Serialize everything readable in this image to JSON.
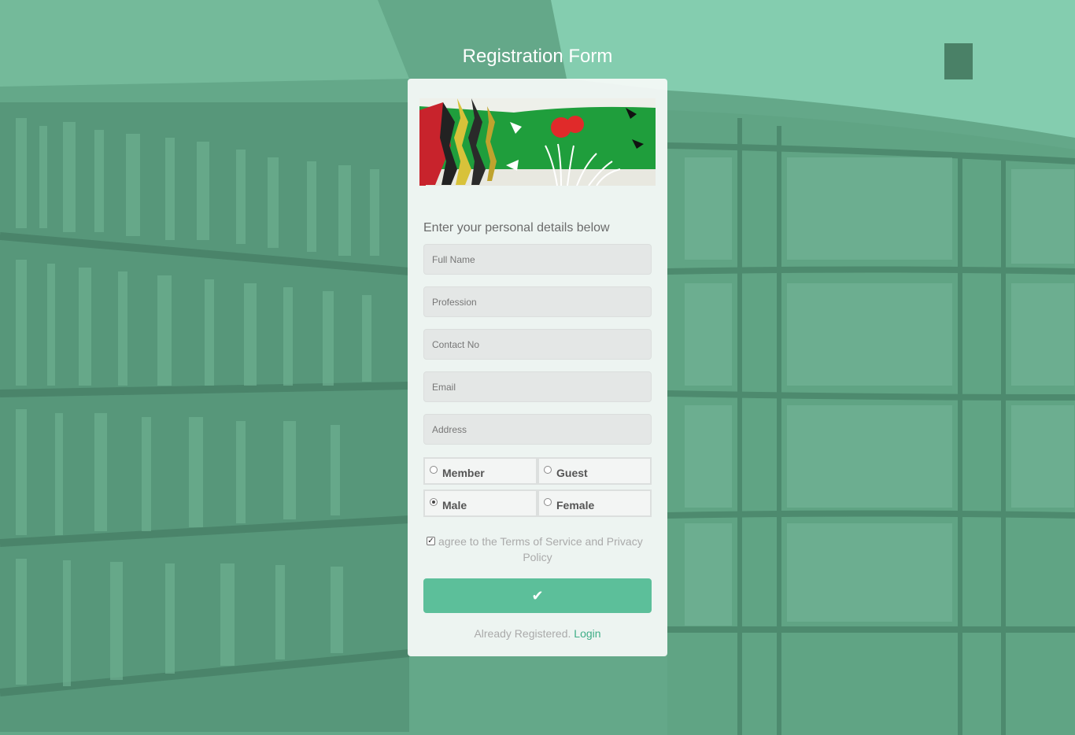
{
  "page": {
    "title": "Registration Form"
  },
  "form": {
    "subtitle": "Enter your personal details below",
    "fields": {
      "full_name": "Full Name",
      "profession": "Profession",
      "contact": "Contact No",
      "email": "Email",
      "address": "Address"
    },
    "membership": {
      "options": [
        "Member",
        "Guest"
      ],
      "selected": null
    },
    "gender": {
      "options": [
        "Male",
        "Female"
      ],
      "selected": "Male"
    },
    "terms": {
      "label": "I agree to the Terms of Service and Privacy Policy",
      "checked": true
    },
    "submit_icon": "check-icon",
    "login": {
      "prompt": "Already Registered.",
      "link": "Login"
    }
  },
  "colors": {
    "accent": "#5cbf9a",
    "link": "#3fae87",
    "overlay": "#6fb999"
  }
}
